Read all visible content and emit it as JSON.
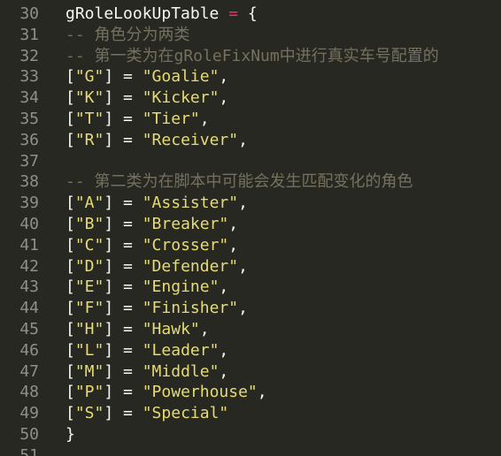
{
  "editor": {
    "colors": {
      "background": "#272822",
      "line_number": "#8f908a",
      "comment": "#75715e",
      "operator": "#f92672",
      "string": "#e6db74",
      "text": "#f8f8f2"
    },
    "lines": [
      {
        "num": "30",
        "tokens": [
          {
            "t": "gRoleLookUpTable ",
            "c": "plain"
          },
          {
            "t": "=",
            "c": "op"
          },
          {
            "t": " {",
            "c": "plain"
          }
        ]
      },
      {
        "num": "31",
        "tokens": [
          {
            "t": "-- 角色分为两类",
            "c": "comment"
          }
        ]
      },
      {
        "num": "32",
        "tokens": [
          {
            "t": "-- 第一类为在gRoleFixNum中进行真实车号配置的",
            "c": "comment"
          }
        ]
      },
      {
        "num": "33",
        "tokens": [
          {
            "t": "[",
            "c": "plain"
          },
          {
            "t": "\"G\"",
            "c": "str"
          },
          {
            "t": "] = ",
            "c": "plain"
          },
          {
            "t": "\"Goalie\"",
            "c": "str"
          },
          {
            "t": ",",
            "c": "plain"
          }
        ]
      },
      {
        "num": "34",
        "tokens": [
          {
            "t": "[",
            "c": "plain"
          },
          {
            "t": "\"K\"",
            "c": "str"
          },
          {
            "t": "] = ",
            "c": "plain"
          },
          {
            "t": "\"Kicker\"",
            "c": "str"
          },
          {
            "t": ",",
            "c": "plain"
          }
        ]
      },
      {
        "num": "35",
        "tokens": [
          {
            "t": "[",
            "c": "plain"
          },
          {
            "t": "\"T\"",
            "c": "str"
          },
          {
            "t": "] = ",
            "c": "plain"
          },
          {
            "t": "\"Tier\"",
            "c": "str"
          },
          {
            "t": ",",
            "c": "plain"
          }
        ]
      },
      {
        "num": "36",
        "tokens": [
          {
            "t": "[",
            "c": "plain"
          },
          {
            "t": "\"R\"",
            "c": "str"
          },
          {
            "t": "] = ",
            "c": "plain"
          },
          {
            "t": "\"Receiver\"",
            "c": "str"
          },
          {
            "t": ",",
            "c": "plain"
          }
        ]
      },
      {
        "num": "37",
        "tokens": []
      },
      {
        "num": "38",
        "tokens": [
          {
            "t": "-- 第二类为在脚本中可能会发生匹配变化的角色",
            "c": "comment"
          }
        ]
      },
      {
        "num": "39",
        "tokens": [
          {
            "t": "[",
            "c": "plain"
          },
          {
            "t": "\"A\"",
            "c": "str"
          },
          {
            "t": "] = ",
            "c": "plain"
          },
          {
            "t": "\"Assister\"",
            "c": "str"
          },
          {
            "t": ",",
            "c": "plain"
          }
        ]
      },
      {
        "num": "40",
        "tokens": [
          {
            "t": "[",
            "c": "plain"
          },
          {
            "t": "\"B\"",
            "c": "str"
          },
          {
            "t": "] = ",
            "c": "plain"
          },
          {
            "t": "\"Breaker\"",
            "c": "str"
          },
          {
            "t": ",",
            "c": "plain"
          }
        ]
      },
      {
        "num": "41",
        "tokens": [
          {
            "t": "[",
            "c": "plain"
          },
          {
            "t": "\"C\"",
            "c": "str"
          },
          {
            "t": "] = ",
            "c": "plain"
          },
          {
            "t": "\"Crosser\"",
            "c": "str"
          },
          {
            "t": ",",
            "c": "plain"
          }
        ]
      },
      {
        "num": "42",
        "tokens": [
          {
            "t": "[",
            "c": "plain"
          },
          {
            "t": "\"D\"",
            "c": "str"
          },
          {
            "t": "] = ",
            "c": "plain"
          },
          {
            "t": "\"Defender\"",
            "c": "str"
          },
          {
            "t": ",",
            "c": "plain"
          }
        ]
      },
      {
        "num": "43",
        "tokens": [
          {
            "t": "[",
            "c": "plain"
          },
          {
            "t": "\"E\"",
            "c": "str"
          },
          {
            "t": "] = ",
            "c": "plain"
          },
          {
            "t": "\"Engine\"",
            "c": "str"
          },
          {
            "t": ",",
            "c": "plain"
          }
        ]
      },
      {
        "num": "44",
        "tokens": [
          {
            "t": "[",
            "c": "plain"
          },
          {
            "t": "\"F\"",
            "c": "str"
          },
          {
            "t": "] = ",
            "c": "plain"
          },
          {
            "t": "\"Finisher\"",
            "c": "str"
          },
          {
            "t": ",",
            "c": "plain"
          }
        ]
      },
      {
        "num": "45",
        "tokens": [
          {
            "t": "[",
            "c": "plain"
          },
          {
            "t": "\"H\"",
            "c": "str"
          },
          {
            "t": "] = ",
            "c": "plain"
          },
          {
            "t": "\"Hawk\"",
            "c": "str"
          },
          {
            "t": ",",
            "c": "plain"
          }
        ]
      },
      {
        "num": "46",
        "tokens": [
          {
            "t": "[",
            "c": "plain"
          },
          {
            "t": "\"L\"",
            "c": "str"
          },
          {
            "t": "] = ",
            "c": "plain"
          },
          {
            "t": "\"Leader\"",
            "c": "str"
          },
          {
            "t": ",",
            "c": "plain"
          }
        ]
      },
      {
        "num": "47",
        "tokens": [
          {
            "t": "[",
            "c": "plain"
          },
          {
            "t": "\"M\"",
            "c": "str"
          },
          {
            "t": "] = ",
            "c": "plain"
          },
          {
            "t": "\"Middle\"",
            "c": "str"
          },
          {
            "t": ",",
            "c": "plain"
          }
        ]
      },
      {
        "num": "48",
        "tokens": [
          {
            "t": "[",
            "c": "plain"
          },
          {
            "t": "\"P\"",
            "c": "str"
          },
          {
            "t": "] = ",
            "c": "plain"
          },
          {
            "t": "\"Powerhouse\"",
            "c": "str"
          },
          {
            "t": ",",
            "c": "plain"
          }
        ]
      },
      {
        "num": "49",
        "tokens": [
          {
            "t": "[",
            "c": "plain"
          },
          {
            "t": "\"S\"",
            "c": "str"
          },
          {
            "t": "] = ",
            "c": "plain"
          },
          {
            "t": "\"Special\"",
            "c": "str"
          }
        ]
      },
      {
        "num": "50",
        "tokens": [
          {
            "t": "}",
            "c": "plain"
          }
        ]
      },
      {
        "num": "51",
        "tokens": []
      }
    ]
  }
}
